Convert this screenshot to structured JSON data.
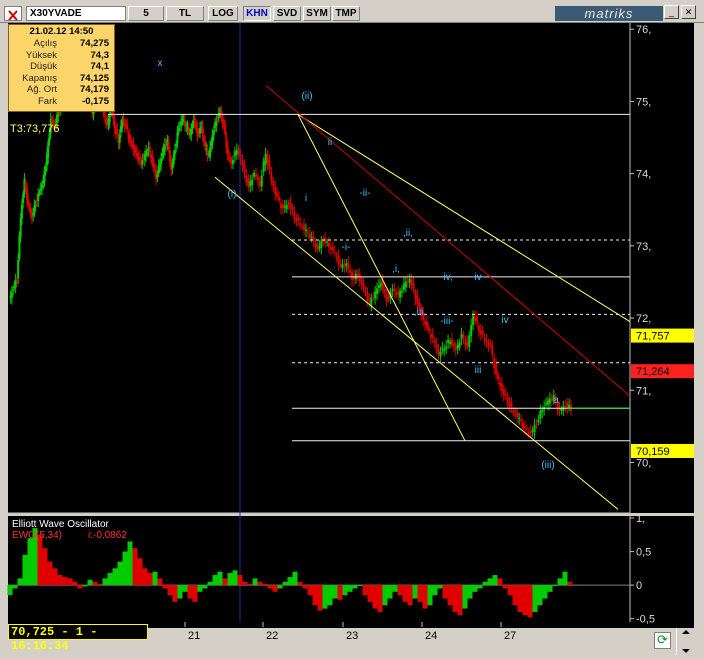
{
  "toolbar": {
    "symbol": "X30YVADE",
    "buttons": [
      "5",
      "TL",
      "LOG",
      "KHN",
      "SVD",
      "SYM",
      "TMP"
    ],
    "active": "KHN",
    "logo": "matriks"
  },
  "info_box": {
    "datetime": "21.02.12 14:50",
    "rows": [
      {
        "label": "Açılış",
        "value": "74,275"
      },
      {
        "label": "Yüksek",
        "value": "74,3"
      },
      {
        "label": "Düşük",
        "value": "74,1"
      },
      {
        "label": "Kapanış",
        "value": "74,125"
      },
      {
        "label": "Ağ. Ort",
        "value": "74,179"
      },
      {
        "label": "Fark",
        "value": "-0,175"
      }
    ]
  },
  "status": "70,725 - 1 - 16:16:34",
  "colors": {
    "background": "#000000",
    "up": "#00cc00",
    "down": "#e00000",
    "channel": "#ffff66",
    "trendline": "#cc0000",
    "level_line": "#f0f0f0",
    "wave_label": "#40c0ff",
    "price_tag_yellow": "#ffff00",
    "price_tag_red": "#ff2020"
  },
  "chart_data": [
    {
      "type": "candlestick",
      "title": "",
      "indicator_label": "T3:73,776",
      "y_ticks": [
        "76,",
        "75,",
        "74,",
        "73,",
        "72,",
        "71,",
        "70,"
      ],
      "y_tick_values": [
        76,
        75,
        74,
        73,
        72,
        71,
        70
      ],
      "ylim": [
        69.3,
        76.1
      ],
      "x_ticks": [
        "21",
        "22",
        "23",
        "24",
        "27"
      ],
      "price_tags": [
        {
          "label": "71,757",
          "value": 71.757,
          "color": "yellow"
        },
        {
          "label": "71,264",
          "value": 71.264,
          "color": "red"
        },
        {
          "label": "70,159",
          "value": 70.159,
          "color": "yellow"
        }
      ],
      "horizontal_levels": [
        {
          "value": 74.82,
          "style": "solid"
        },
        {
          "value": 73.08,
          "style": "dashed"
        },
        {
          "value": 72.57,
          "style": "solid"
        },
        {
          "value": 72.05,
          "style": "dashed"
        },
        {
          "value": 71.38,
          "style": "dashed"
        },
        {
          "value": 70.75,
          "style": "solid"
        },
        {
          "value": 70.3,
          "style": "solid"
        }
      ],
      "wave_labels": [
        {
          "text": "x",
          "value": 75.5
        },
        {
          "text": "(i)",
          "value": 73.8
        },
        {
          "text": "(ii)",
          "value": 75.0
        },
        {
          "text": "i",
          "value": 73.7
        },
        {
          "text": "ii",
          "value": 74.4
        },
        {
          "text": "-ii-",
          "value": 73.75
        },
        {
          "text": "-i-",
          "value": 73.0
        },
        {
          "text": ",ii,",
          "value": 73.2
        },
        {
          "text": ",i,",
          "value": 72.75
        },
        {
          "text": "iv,",
          "value": 72.6
        },
        {
          "text": "-iv-",
          "value": 72.6
        },
        {
          "text": ",iii,",
          "value": 72.1
        },
        {
          "text": "-iii-",
          "value": 71.9
        },
        {
          "text": "iv",
          "value": 72.0
        },
        {
          "text": "iii",
          "value": 71.45
        },
        {
          "text": "a",
          "value": 71.0
        },
        {
          "text": "(iii)",
          "value": 70.2
        }
      ],
      "series": [
        {
          "name": "",
          "segments": [
            [
              72.25,
              72.4,
              72.55,
              73.4,
              73.9,
              73.55,
              73.4,
              73.6,
              73.75,
              73.9,
              74.25,
              74.75,
              74.65,
              74.85,
              74.95,
              74.95,
              75.05,
              75.15,
              75.3,
              75.2,
              75.1,
              75.05,
              74.85,
              75.0,
              75.25,
              74.85,
              74.65,
              74.9,
              74.65,
              74.45,
              74.75,
              74.65,
              74.45,
              74.35,
              74.25,
              74.15,
              74.25,
              74.35,
              74.15,
              73.95,
              74.15,
              74.35,
              74.45,
              74.05,
              74.35,
              74.65,
              74.75,
              74.65,
              74.55,
              74.75,
              74.55,
              74.65,
              74.35,
              74.25,
              74.55,
              74.75,
              74.85,
              74.65,
              74.25,
              74.15
            ],
            [
              74.15,
              74.35,
              74.1,
              73.8,
              74.0,
              73.85,
              74.3,
              73.9,
              73.65,
              73.5,
              73.6,
              73.4,
              73.3,
              73.2,
              73.1,
              72.95,
              73.1,
              73.0,
              72.9,
              72.7,
              72.75,
              72.55,
              72.6,
              72.4,
              72.2,
              72.35,
              72.5,
              72.25,
              72.4,
              72.3,
              72.45,
              72.55,
              72.3,
              72.05,
              71.85,
              71.7,
              71.5,
              71.6,
              71.7,
              71.55,
              71.75,
              71.6,
              72.05,
              71.85,
              71.7,
              71.6,
              71.2,
              71.0,
              70.85,
              70.7,
              70.6,
              70.45,
              70.4,
              70.55,
              70.75,
              70.85,
              70.9,
              70.7,
              70.8,
              70.75
            ]
          ]
        }
      ]
    },
    {
      "type": "bar",
      "title": "Elliott Wave Oscillator",
      "legend": [
        {
          "text": "EWO(5,34)",
          "color": "#ff3030"
        },
        {
          "text": "i:-0,0862",
          "color": "#ff3030"
        }
      ],
      "y_ticks": [
        "1,",
        "0,5",
        "0",
        "-0,5"
      ],
      "y_tick_values": [
        1,
        0.5,
        0,
        -0.5
      ],
      "ylim": [
        -0.52,
        1.0
      ],
      "series": [
        {
          "name": "",
          "values": [
            -0.15,
            -0.05,
            0.1,
            0.45,
            0.7,
            0.85,
            0.75,
            0.55,
            0.35,
            0.25,
            0.15,
            0.12,
            0.1,
            0.05,
            -0.05,
            -0.02,
            0.08,
            0.05,
            0.02,
            0.1,
            0.18,
            0.25,
            0.35,
            0.5,
            0.65,
            0.55,
            0.4,
            0.25,
            0.18,
            0.2,
            0.1,
            -0.05,
            -0.15,
            -0.25,
            -0.2,
            -0.1,
            -0.2,
            -0.25,
            -0.1,
            -0.05,
            0.05,
            0.15,
            0.2,
            0.1,
            0.18,
            0.22,
            0.15,
            0.05,
            0.02,
            0.1,
            0.05,
            0.02,
            -0.05,
            -0.1,
            -0.05,
            0.05,
            0.12,
            0.2,
            0.05,
            -0.05,
            -0.15,
            -0.3,
            -0.38,
            -0.35,
            -0.3,
            -0.2,
            -0.22,
            -0.15,
            -0.1,
            -0.05,
            0.0,
            -0.15,
            -0.25,
            -0.35,
            -0.4,
            -0.3,
            -0.2,
            -0.1,
            -0.15,
            -0.25,
            -0.3,
            -0.2,
            -0.25,
            -0.35,
            -0.3,
            -0.15,
            -0.05,
            -0.2,
            -0.3,
            -0.4,
            -0.45,
            -0.35,
            -0.2,
            -0.1,
            -0.05,
            0.05,
            0.1,
            0.15,
            0.1,
            -0.05,
            -0.15,
            -0.3,
            -0.4,
            -0.45,
            -0.48,
            -0.4,
            -0.3,
            -0.2,
            -0.1,
            0.0,
            0.1,
            0.2,
            0.05
          ]
        }
      ]
    }
  ]
}
